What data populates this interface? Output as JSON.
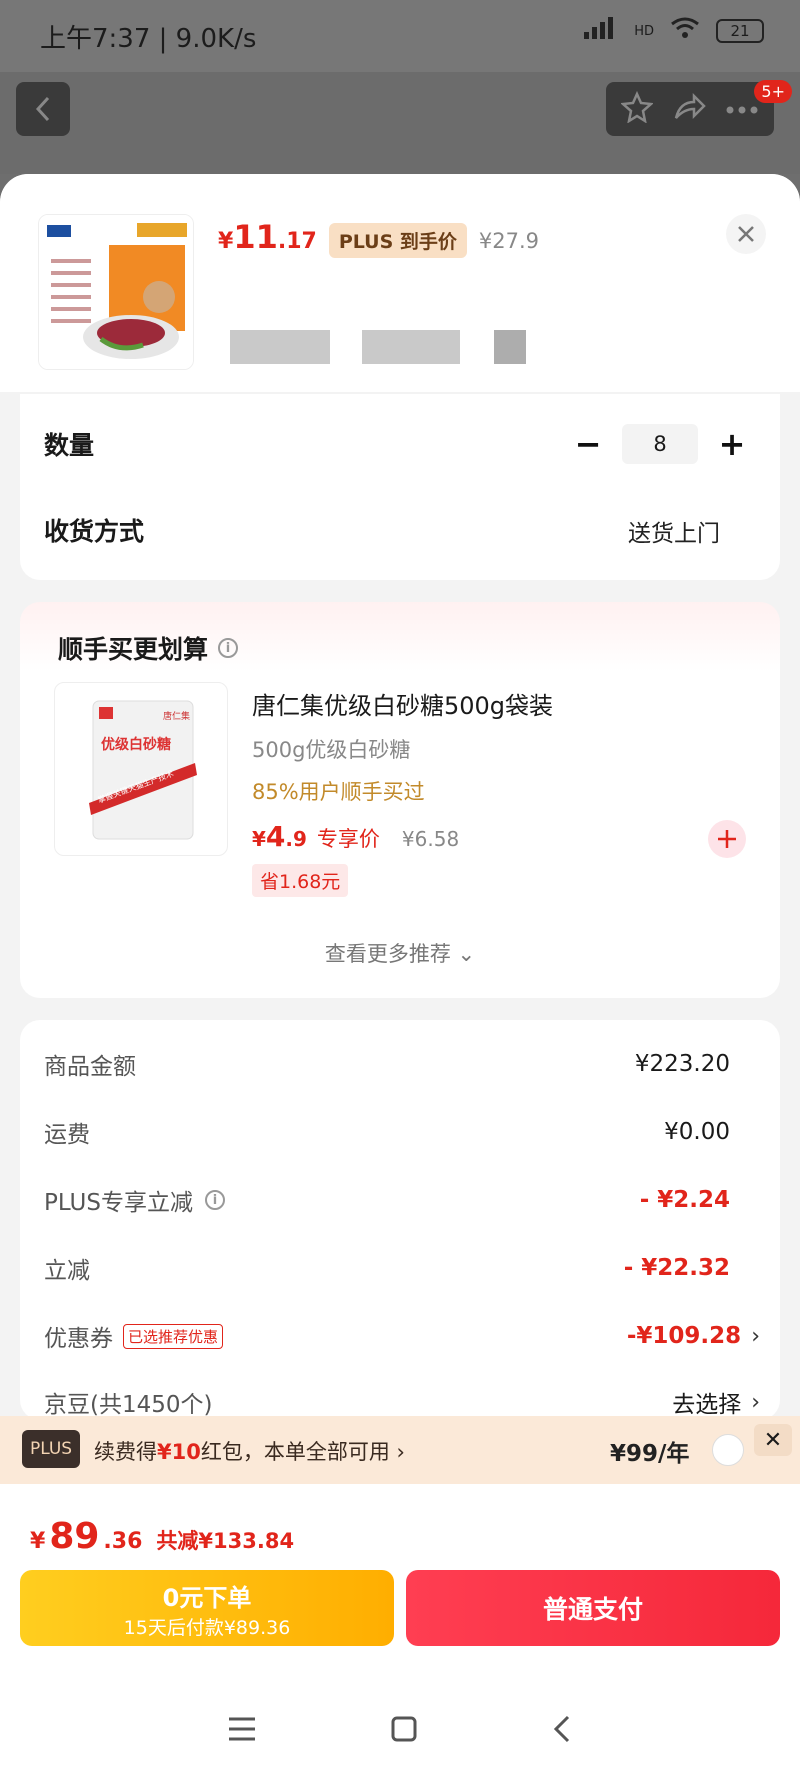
{
  "status": {
    "time": "上午7:37 | 9.0K/s",
    "net": "HD",
    "battery": "21"
  },
  "topbar": {
    "badge": "5+"
  },
  "product": {
    "price_yen": "¥",
    "price_int": "11",
    "price_dec": ".17",
    "plus_tag": "PLUS 到手价",
    "orig_price": "¥27.9"
  },
  "quantity": {
    "label": "数量",
    "value": "8",
    "minus": "−",
    "plus": "+"
  },
  "delivery": {
    "label": "收货方式",
    "value": "送货上门"
  },
  "recommend": {
    "title": "顺手买更划算",
    "name": "唐仁集优级白砂糖500g袋装",
    "sub": "500g优级白砂糖",
    "hint": "85%用户顺手买过",
    "price_yen": "¥",
    "price_int": "4",
    "price_dec": ".9",
    "price_label": "专享价",
    "orig_price": "¥6.58",
    "save": "省1.68元",
    "more": "查看更多推荐 ⌄",
    "thumb_text": "优级白砂糖",
    "thumb_brand": "唐仁集",
    "thumb_band": "掌握关键天猫生产技术"
  },
  "summary": {
    "rows": [
      {
        "label": "商品金额",
        "value": "¥223.20"
      },
      {
        "label": "运费",
        "value": "¥0.00"
      },
      {
        "label": "PLUS专享立减",
        "value": "- ¥2.24"
      },
      {
        "label": "立减",
        "value": "- ¥22.32"
      },
      {
        "label": "优惠券",
        "tag": "已选推荐优惠",
        "value": "-¥109.28"
      },
      {
        "label": "京豆(共1450个)",
        "value": "去选择"
      }
    ]
  },
  "plus_banner": {
    "logo": "PLUS",
    "text_pre": "续费得",
    "text_hl": "¥10",
    "text_post": "红包，本单全部可用 ›",
    "fee": "¥99/年",
    "close": "✕"
  },
  "footer": {
    "total_yen": "¥",
    "total_int": "89",
    "total_dec": ".36",
    "reduce": "共减¥133.84",
    "zero_line1": "0元下单",
    "zero_line2": "15天后付款¥89.36",
    "pay_label": "普通支付"
  },
  "colors": {
    "accent": "#e1251b",
    "gold": "#ffae00",
    "pay": "#f5283a"
  }
}
